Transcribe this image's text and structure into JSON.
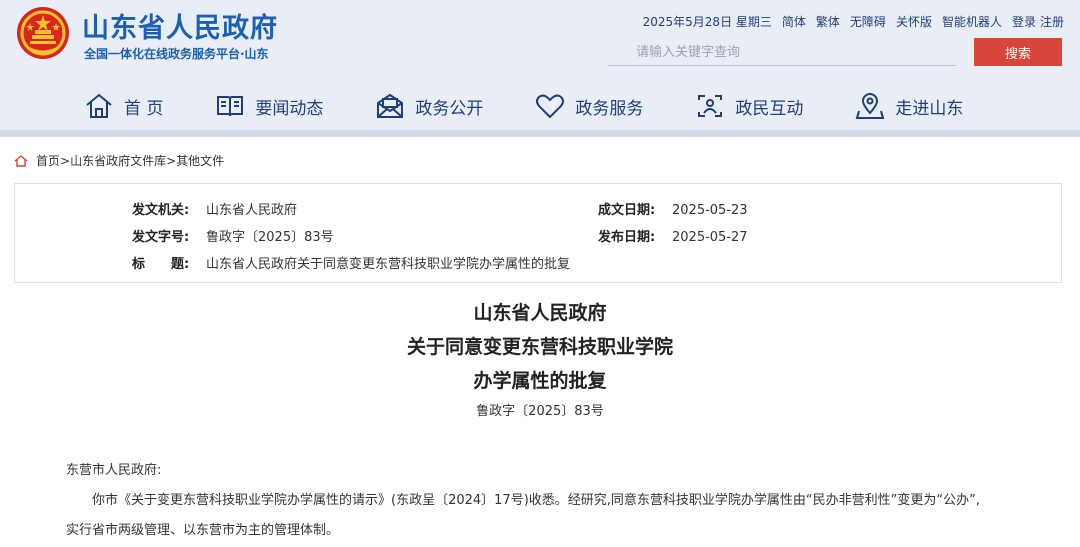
{
  "header": {
    "site_title": "山东省人民政府",
    "site_subtitle": "全国一体化在线政务服务平台·山东",
    "date": "2025年5月28日 星期三",
    "links": [
      "简体",
      "繁体",
      "无障碍",
      "关怀版",
      "智能机器人",
      "登录",
      "注册"
    ],
    "search_placeholder": "请输入关键字查询",
    "search_label": "搜索",
    "nav": [
      "首 页",
      "要闻动态",
      "政务公开",
      "政务服务",
      "政民互动",
      "走进山东"
    ]
  },
  "breadcrumb": {
    "items": [
      "首页",
      "山东省政府文件库",
      "其他文件"
    ],
    "separator": ">"
  },
  "info": {
    "issuer_label": "发文机关:",
    "issuer": "山东省人民政府",
    "doc_no_label": "发文字号:",
    "doc_no": "鲁政字〔2025〕83号",
    "subject_label": "标　　题:",
    "subject": "山东省人民政府关于同意变更东营科技职业学院办学属性的批复",
    "written_date_label": "成文日期:",
    "written_date": "2025-05-23",
    "publish_date_label": "发布日期:",
    "publish_date": "2025-05-27"
  },
  "document": {
    "title_lines": [
      "山东省人民政府",
      "关于同意变更东营科技职业学院",
      "办学属性的批复"
    ],
    "number": "鲁政字〔2025〕83号",
    "salutation": "东营市人民政府:",
    "paragraph": "你市《关于变更东营科技职业学院办学属性的请示》(东政呈〔2024〕17号)收悉。经研究,同意东营科技职业学院办学属性由“民办非营利性”变更为“公办”,实行省市两级管理、以东营市为主的管理体制。"
  },
  "colors": {
    "brand_blue": "#1d5fb0",
    "header_bg": "#e9eef6",
    "search_red": "#d8453a"
  }
}
